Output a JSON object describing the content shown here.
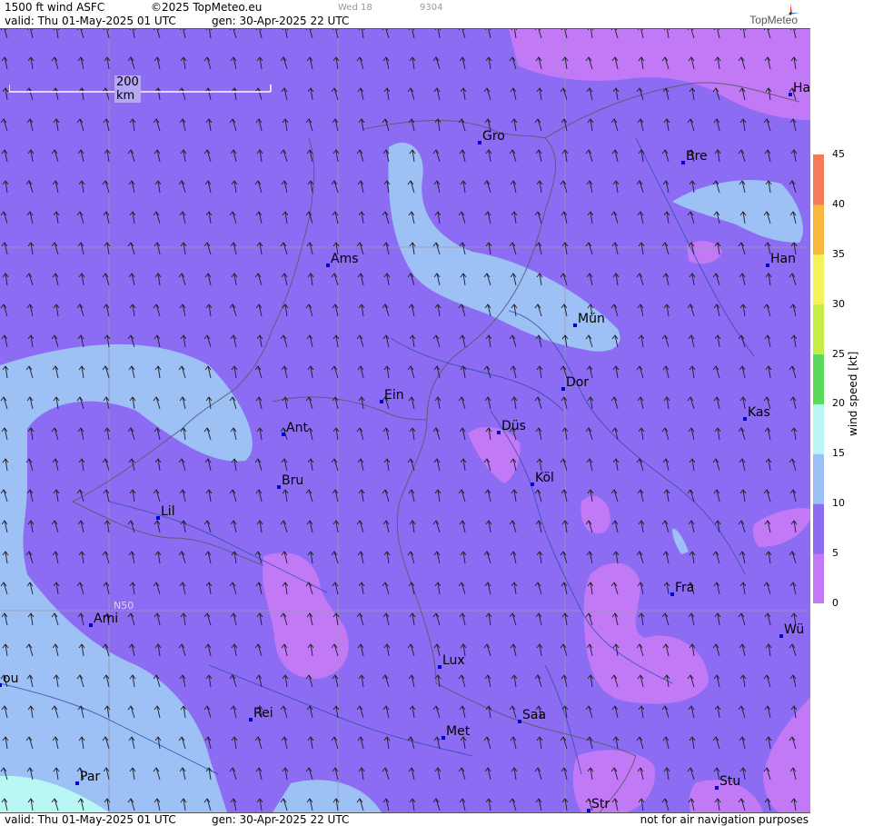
{
  "header": {
    "title": "1500 ft wind ASFC",
    "copyright": "©2025 TopMeteo.eu",
    "valid": "valid:  Thu  01-May-2025  01 UTC",
    "gen": "gen: 30-Apr-2025 22 UTC",
    "extra1": "Wed 18",
    "extra2": "9304",
    "logo": "TopMeteo"
  },
  "footer": {
    "valid": "valid:  Thu  01-May-2025  01 UTC",
    "gen": "gen: 30-Apr-2025 22 UTC",
    "notice": "not for air navigation purposes"
  },
  "map": {
    "scale_label": "200 km",
    "lat_label": "N50",
    "cities": [
      "Ha",
      "Gro",
      "Bre",
      "Ams",
      "Han",
      "Mün",
      "Ein",
      "Dor",
      "Kas",
      "Ant",
      "Düs",
      "Bru",
      "Köl",
      "Lil",
      "Fra",
      "Ami",
      "Wü",
      "Lux",
      "ou",
      "Rei",
      "Saa",
      "Met",
      "Par",
      "Stu",
      "Str"
    ]
  },
  "legend": {
    "title": "wind  speed  [kt]",
    "ticks": [
      "45",
      "40",
      "35",
      "30",
      "25",
      "20",
      "15",
      "10",
      "5",
      "0"
    ],
    "colors": [
      "#c279f5",
      "#8c6cf2",
      "#9dc0f5",
      "#b8f7f3",
      "#5ad95c",
      "#c8ec46",
      "#f3f35a",
      "#f7b83f",
      "#f47a5a"
    ]
  }
}
